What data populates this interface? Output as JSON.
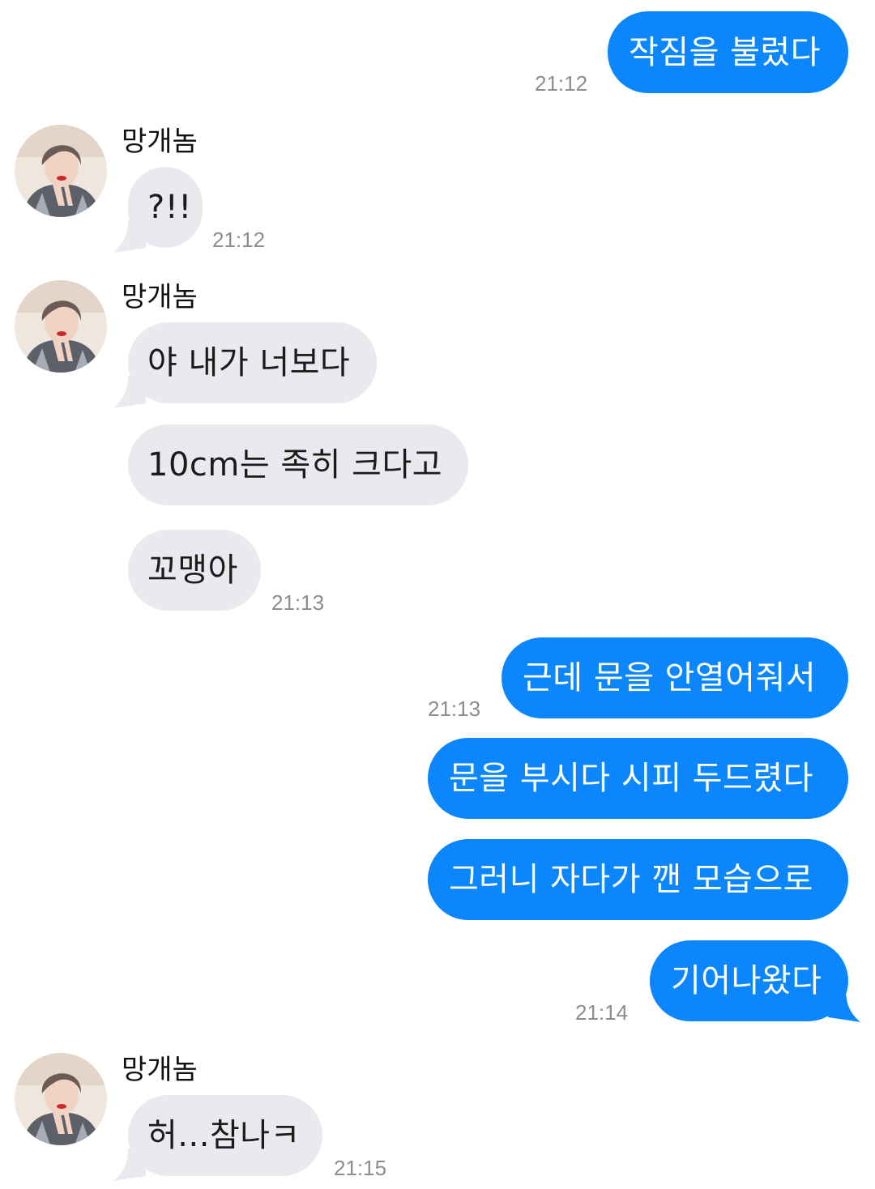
{
  "contact": {
    "name": "망개놈"
  },
  "messages": [
    {
      "id": "m1",
      "direction": "outgoing",
      "text": "작짐을 불렀다",
      "time": "21:12"
    },
    {
      "id": "m2",
      "direction": "incoming",
      "sender": "망개놈",
      "text": "?!!",
      "time": "21:12"
    },
    {
      "id": "m3",
      "direction": "incoming",
      "sender": "망개놈",
      "text": "야 내가 너보다"
    },
    {
      "id": "m4",
      "direction": "incoming",
      "text": "10cm는 족히 크다고"
    },
    {
      "id": "m5",
      "direction": "incoming",
      "text": "꼬맹아",
      "time": "21:13"
    },
    {
      "id": "m6",
      "direction": "outgoing",
      "text": "근데 문을 안열어줘서",
      "time": "21:13"
    },
    {
      "id": "m7",
      "direction": "outgoing",
      "text": "문을 부시다 시피 두드렸다"
    },
    {
      "id": "m8",
      "direction": "outgoing",
      "text": "그러니 자다가 깬 모습으로"
    },
    {
      "id": "m9",
      "direction": "outgoing",
      "text": "기어나왔다",
      "time": "21:14"
    },
    {
      "id": "m10",
      "direction": "incoming",
      "sender": "망개놈",
      "text": "허...참나ㅋ",
      "time": "21:15"
    }
  ],
  "colors": {
    "outgoing_bubble": "#0b86fc",
    "incoming_bubble": "#e9e9ee",
    "timestamp": "#8d8d8d",
    "background": "#ffffff"
  },
  "icons": {
    "avatar": "contact-avatar-photo"
  }
}
